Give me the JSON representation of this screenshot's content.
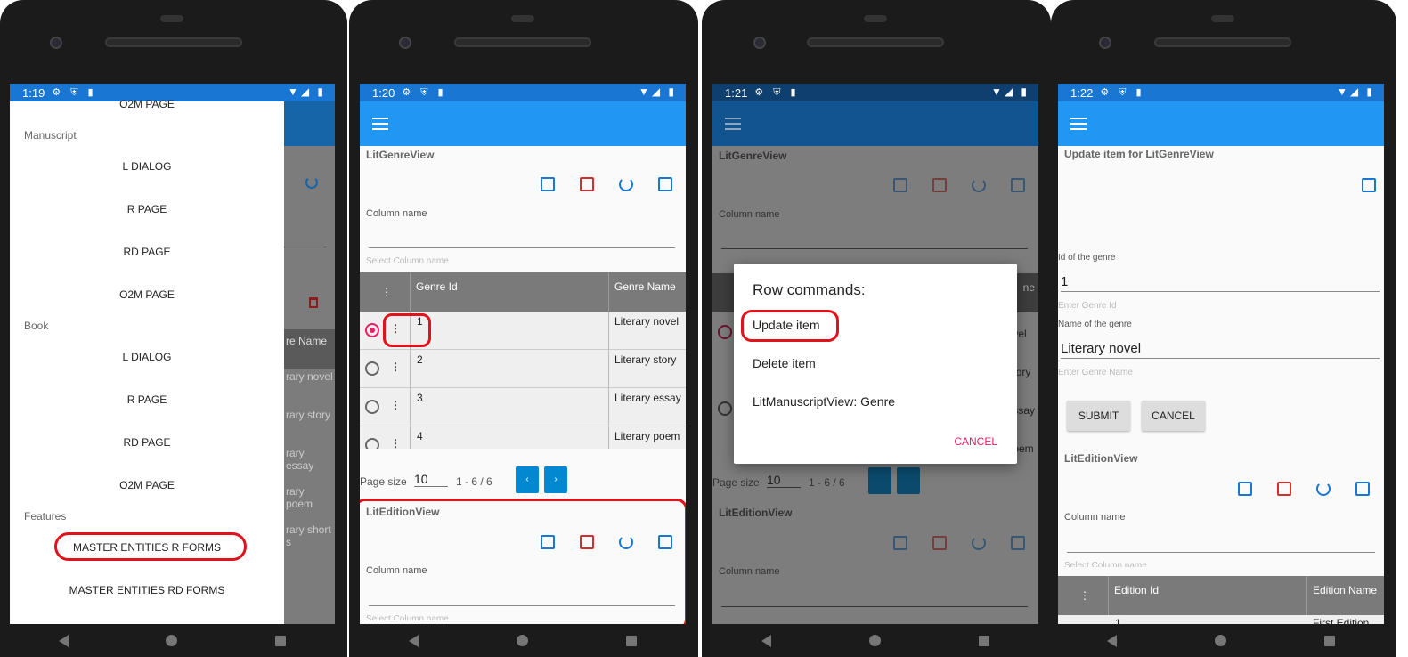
{
  "status": {
    "icons": "⚙ ⛨ ▮",
    "right": "▼◢ ▮"
  },
  "phone1": {
    "time": "1:19",
    "drawer": {
      "top_item": "O2M PAGE",
      "sections": [
        {
          "title": "Manuscript",
          "items": [
            "L DIALOG",
            "R PAGE",
            "RD PAGE",
            "O2M PAGE"
          ]
        },
        {
          "title": "Book",
          "items": [
            "L DIALOG",
            "R PAGE",
            "RD PAGE",
            "O2M PAGE"
          ]
        },
        {
          "title": "Features",
          "items": [
            "MASTER ENTITIES R FORMS",
            "MASTER ENTITIES RD FORMS"
          ]
        }
      ]
    },
    "behind": {
      "col": "re Name",
      "rows": [
        "rary novel",
        "rary story",
        "rary essay",
        "rary poem",
        "rary short s"
      ]
    }
  },
  "phone2": {
    "time": "1:20",
    "genre_title": "LitGenreView",
    "column_name": "Column name",
    "select_hint": "Select Column name",
    "headers": [
      "⋮",
      "Genre Id",
      "Genre Name"
    ],
    "rows": [
      {
        "id": "1",
        "name": "Literary novel",
        "selected": true
      },
      {
        "id": "2",
        "name": "Literary story",
        "selected": false
      },
      {
        "id": "3",
        "name": "Literary essay",
        "selected": false
      },
      {
        "id": "4",
        "name": "Literary poem",
        "selected": false
      }
    ],
    "page_size_label": "Page size",
    "page_size": "10",
    "range": "1  -  6  /  6",
    "prev": "‹",
    "next": "›",
    "edition_title": "LitEditionView"
  },
  "phone3": {
    "time": "1:21",
    "dialog": {
      "title": "Row commands:",
      "items": [
        "Update item",
        "Delete item",
        "LitManuscriptView: Genre"
      ],
      "cancel": "CANCEL"
    },
    "behind_tail": [
      "vel",
      "tory",
      "ssay",
      "oem"
    ],
    "behind_head": "ne"
  },
  "phone4": {
    "time": "1:22",
    "title": "Update item for LitGenreView",
    "id_label": "Id of the genre",
    "id_value": "1",
    "id_hint": "Enter Genre Id",
    "name_label": "Name of the genre",
    "name_value": "Literary novel",
    "name_hint": "Enter Genre Name",
    "submit": "SUBMIT",
    "cancel": "CANCEL",
    "edition_title": "LitEditionView",
    "column_name": "Column name",
    "select_hint": "Select Column name",
    "headers": [
      "⋮",
      "Edition Id",
      "Edition Name"
    ],
    "row_partial": [
      "1",
      "First Edition"
    ]
  },
  "colors": {
    "appbar": "#2196f3",
    "statusbar": "#1976d2",
    "highlight": "#e0121c",
    "accent": "#e91e63",
    "pager": "#0288d1"
  }
}
